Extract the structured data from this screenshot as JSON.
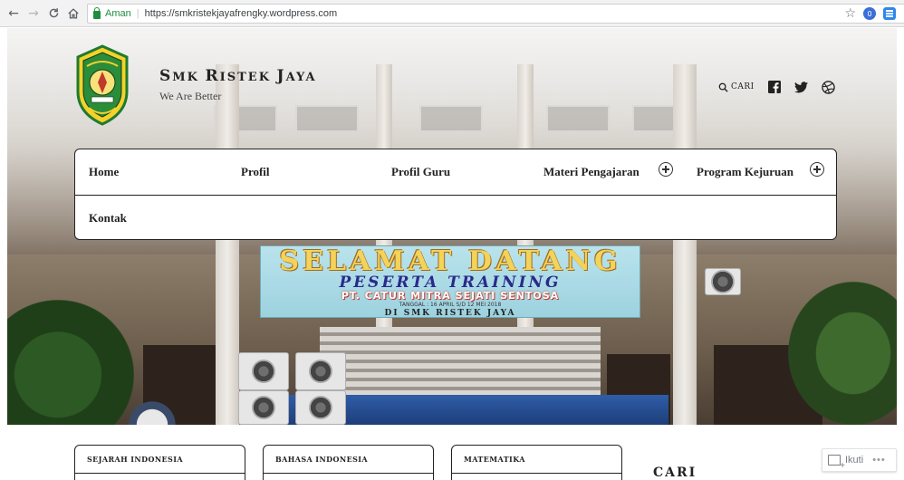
{
  "browser": {
    "secure_label": "Aman",
    "url": "https://smkristekjayafrengky.wordpress.com",
    "nav_icons": [
      "back-icon",
      "forward-icon",
      "reload-icon",
      "home-icon"
    ],
    "extension_badge": "0"
  },
  "site": {
    "title_initial_s": "S",
    "title_mk": "MK ",
    "title_initial_r": "R",
    "title_istek": "ISTEK ",
    "title_initial_j": "J",
    "title_aya": "AYA",
    "tagline": "We Are Better",
    "search_label": "CARI",
    "social_icons": [
      "facebook-icon",
      "twitter-icon",
      "dribbble-icon"
    ]
  },
  "nav": {
    "items": [
      {
        "label": "Home"
      },
      {
        "label": "Profil"
      },
      {
        "label": "Profil Guru"
      },
      {
        "label": "Materi Pengajaran"
      },
      {
        "label": "Program Kejuruan"
      },
      {
        "label": "Kontak"
      }
    ]
  },
  "hero": {
    "banner": {
      "line1": "SELAMAT DATANG",
      "line2": "PESERTA TRAINING",
      "line3": "PT. CATUR MITRA SEJATI SENTOSA",
      "line4": "TANGGAL : 16 APRIL S/D 12 MEI 2018",
      "line5": "DI SMK RISTEK JAYA"
    }
  },
  "cards": [
    {
      "title": "SEJARAH INDONESIA"
    },
    {
      "title": "BAHASA INDONESIA"
    },
    {
      "title": "MATEMATIKA"
    }
  ],
  "sidebar": {
    "search_widget_title": "CARI"
  },
  "follow": {
    "label": "Ikuti",
    "more": "•••"
  },
  "colors": {
    "secure_green": "#1e8e3e",
    "text_dark": "#222222",
    "logo_yellow": "#f4d22b",
    "logo_green": "#1f7a2e"
  }
}
